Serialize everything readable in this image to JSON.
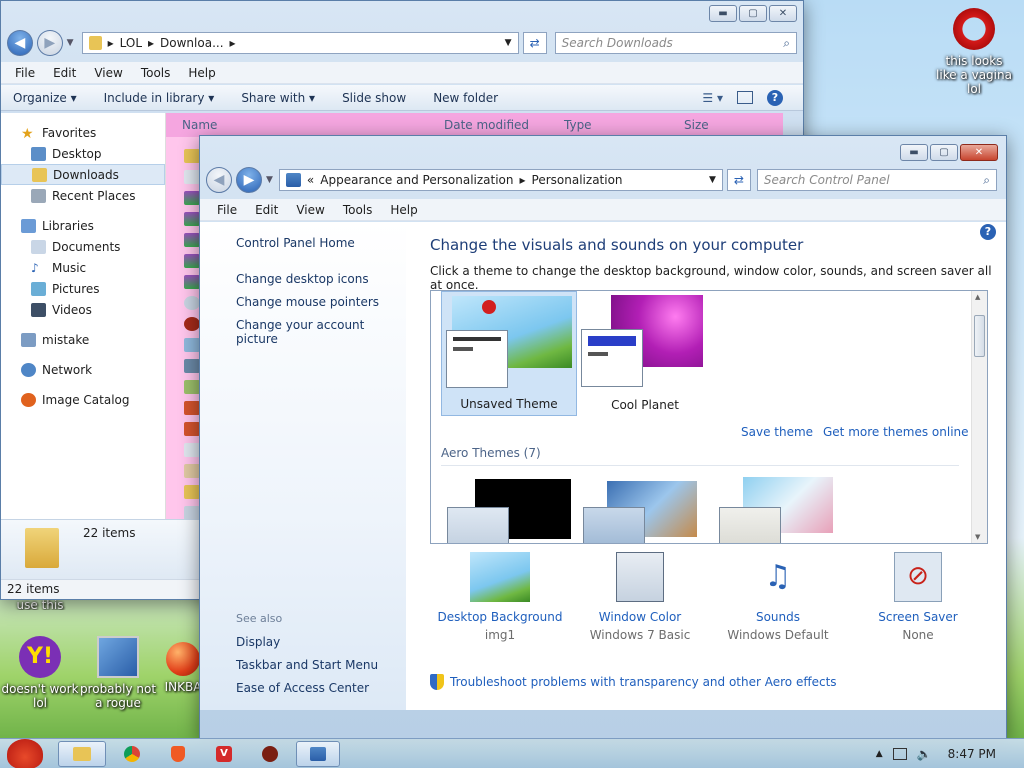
{
  "desktop": {
    "icons": [
      {
        "label": "this looks like a vagina lol",
        "icon": "opera-icon"
      },
      {
        "label": "doesn't work lol",
        "icon": "yahoo-messenger-icon"
      },
      {
        "label": "probably not a rogue",
        "icon": "system-tool-icon"
      },
      {
        "label": "INKBA",
        "icon": "red-ball-icon"
      }
    ],
    "partial_label": "use this"
  },
  "explorer": {
    "breadcrumb": [
      "LOL",
      "Downloa..."
    ],
    "search_placeholder": "Search Downloads",
    "menu": [
      "File",
      "Edit",
      "View",
      "Tools",
      "Help"
    ],
    "toolbar": [
      "Organize",
      "Include in library",
      "Share with",
      "Slide show",
      "New folder"
    ],
    "nav": {
      "favorites": "Favorites",
      "favorites_items": [
        "Desktop",
        "Downloads",
        "Recent Places"
      ],
      "libraries": "Libraries",
      "libraries_items": [
        "Documents",
        "Music",
        "Pictures",
        "Videos"
      ],
      "mistake": "mistake",
      "network": "Network",
      "image_catalog": "Image Catalog"
    },
    "columns": [
      "Name",
      "Date modified",
      "Type",
      "Size"
    ],
    "details_count": "22 items",
    "status": "22 items"
  },
  "control_panel": {
    "breadcrumb": [
      "Appearance and Personalization",
      "Personalization"
    ],
    "search_placeholder": "Search Control Panel",
    "menu": [
      "File",
      "Edit",
      "View",
      "Tools",
      "Help"
    ],
    "left_links": [
      "Control Panel Home",
      "Change desktop icons",
      "Change mouse pointers",
      "Change your account picture"
    ],
    "see_also_label": "See also",
    "see_also": [
      "Display",
      "Taskbar and Start Menu",
      "Ease of Access Center"
    ],
    "title": "Change the visuals and sounds on your computer",
    "subtitle": "Click a theme to change the desktop background, window color, sounds, and screen saver all at once.",
    "my_themes": [
      {
        "name": "Unsaved Theme",
        "selected": true
      },
      {
        "name": "Cool Planet",
        "selected": false
      }
    ],
    "save_theme": "Save theme",
    "get_more": "Get more themes online",
    "aero_header": "Aero Themes (7)",
    "bottom": [
      {
        "label": "Desktop Background",
        "value": "img1",
        "icon": "desktop-background-icon"
      },
      {
        "label": "Window Color",
        "value": "Windows 7 Basic",
        "icon": "window-color-icon"
      },
      {
        "label": "Sounds",
        "value": "Windows Default",
        "icon": "sounds-icon"
      },
      {
        "label": "Screen Saver",
        "value": "None",
        "icon": "screen-saver-icon"
      }
    ],
    "troubleshoot": "Troubleshoot problems with transparency and other Aero effects"
  },
  "taskbar": {
    "time": "8:47 PM",
    "buttons": [
      "explorer-icon",
      "chrome-icon",
      "brave-icon",
      "vivaldi-icon",
      "angry-bird-icon",
      "control-panel-icon"
    ]
  }
}
